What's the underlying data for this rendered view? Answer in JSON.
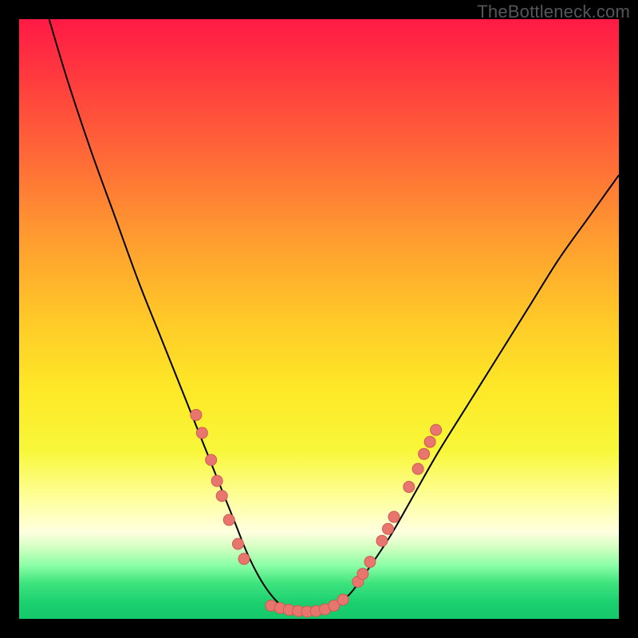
{
  "watermark": "TheBottleneck.com",
  "colors": {
    "frame": "#000000",
    "gradient_top": "#ff1a45",
    "gradient_mid": "#fde927",
    "gradient_bottom": "#16c96b",
    "curve": "#000000",
    "dots_fill": "#e8766f",
    "dots_stroke": "#cf5a54"
  },
  "chart_data": {
    "type": "line",
    "title": "",
    "xlabel": "",
    "ylabel": "",
    "xlim": [
      0,
      100
    ],
    "ylim": [
      0,
      100
    ],
    "series": [
      {
        "name": "bottleneck-curve",
        "x": [
          5,
          8,
          12,
          16,
          20,
          24,
          28,
          30,
          32,
          34,
          36,
          38,
          40,
          42,
          44,
          46,
          48,
          50,
          52,
          55,
          58,
          62,
          66,
          70,
          75,
          80,
          85,
          90,
          95,
          100
        ],
        "y": [
          100,
          90,
          78,
          67,
          56,
          46,
          36,
          31,
          26,
          21,
          16,
          11,
          7,
          4,
          2,
          1,
          1,
          1,
          2,
          4,
          8,
          14,
          21,
          28,
          36,
          44,
          52,
          60,
          67,
          74
        ]
      }
    ],
    "markers": [
      {
        "x": 29.5,
        "y": 34
      },
      {
        "x": 30.5,
        "y": 31
      },
      {
        "x": 32.0,
        "y": 26.5
      },
      {
        "x": 33.0,
        "y": 23
      },
      {
        "x": 33.8,
        "y": 20.5
      },
      {
        "x": 35.0,
        "y": 16.5
      },
      {
        "x": 36.5,
        "y": 12.5
      },
      {
        "x": 37.5,
        "y": 10
      },
      {
        "x": 42.0,
        "y": 2.2
      },
      {
        "x": 43.5,
        "y": 1.8
      },
      {
        "x": 45.0,
        "y": 1.5
      },
      {
        "x": 46.5,
        "y": 1.3
      },
      {
        "x": 48.0,
        "y": 1.2
      },
      {
        "x": 49.5,
        "y": 1.3
      },
      {
        "x": 51.0,
        "y": 1.6
      },
      {
        "x": 52.5,
        "y": 2.2
      },
      {
        "x": 54.0,
        "y": 3.2
      },
      {
        "x": 56.5,
        "y": 6.2
      },
      {
        "x": 57.3,
        "y": 7.5
      },
      {
        "x": 58.5,
        "y": 9.5
      },
      {
        "x": 60.5,
        "y": 13
      },
      {
        "x": 61.5,
        "y": 15
      },
      {
        "x": 62.5,
        "y": 17
      },
      {
        "x": 65.0,
        "y": 22
      },
      {
        "x": 66.5,
        "y": 25
      },
      {
        "x": 67.5,
        "y": 27.5
      },
      {
        "x": 68.5,
        "y": 29.5
      },
      {
        "x": 69.5,
        "y": 31.5
      }
    ]
  }
}
